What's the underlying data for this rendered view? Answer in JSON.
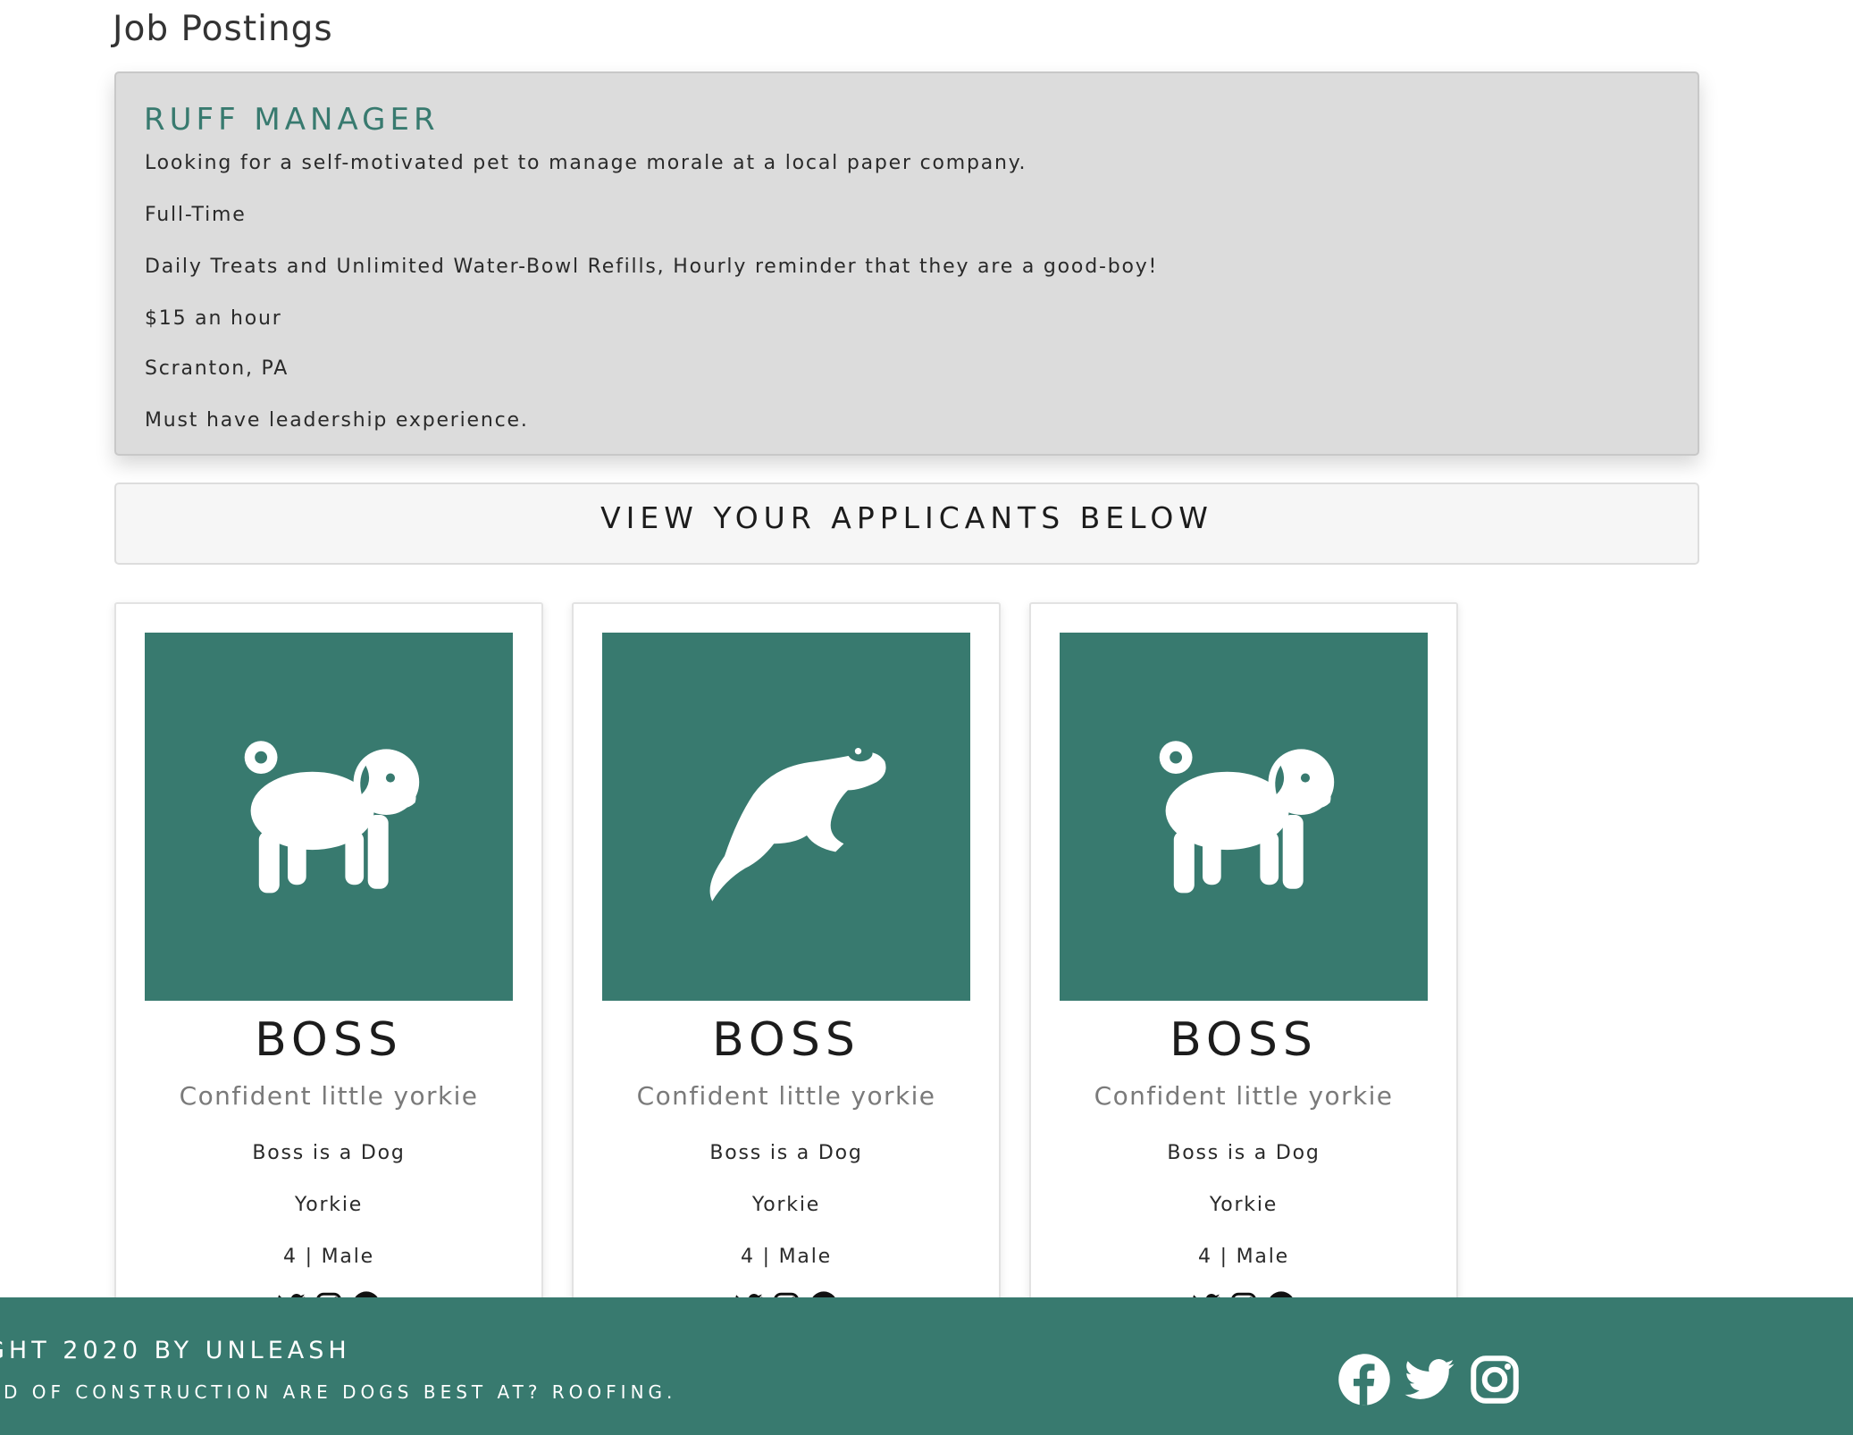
{
  "page": {
    "title": "Job Postings"
  },
  "job": {
    "title": "RUFF MANAGER",
    "description": "Looking for a self-motivated pet to manage morale at a local paper company.",
    "type": "Full-Time",
    "perks": "Daily Treats and Unlimited Water-Bowl Refills, Hourly reminder that they are a good-boy!",
    "pay": "$15 an hour",
    "location": "Scranton, PA",
    "requirements": "Must have leadership experience."
  },
  "banner": {
    "text": "VIEW YOUR APPLICANTS BELOW"
  },
  "applicants": [
    {
      "icon": "pug-icon",
      "name": "BOSS",
      "tagline": "Confident little yorkie",
      "species_line": "Boss is a Dog",
      "breed": "Yorkie",
      "age_sex": "4 | Male"
    },
    {
      "icon": "ferret-icon",
      "name": "BOSS",
      "tagline": "Confident little yorkie",
      "species_line": "Boss is a Dog",
      "breed": "Yorkie",
      "age_sex": "4 | Male"
    },
    {
      "icon": "pug-icon",
      "name": "BOSS",
      "tagline": "Confident little yorkie",
      "species_line": "Boss is a Dog",
      "breed": "Yorkie",
      "age_sex": "4 | Male"
    }
  ],
  "footer": {
    "copyright": "GHT 2020 BY UNLEASH",
    "joke": "ND OF CONSTRUCTION ARE DOGS BEST AT? ROOFING.",
    "social": [
      "facebook-icon",
      "twitter-icon",
      "instagram-icon"
    ]
  },
  "colors": {
    "brand": "#387a6f",
    "job_card_bg": "#dcdcdc",
    "banner_bg": "#f6f6f6"
  }
}
